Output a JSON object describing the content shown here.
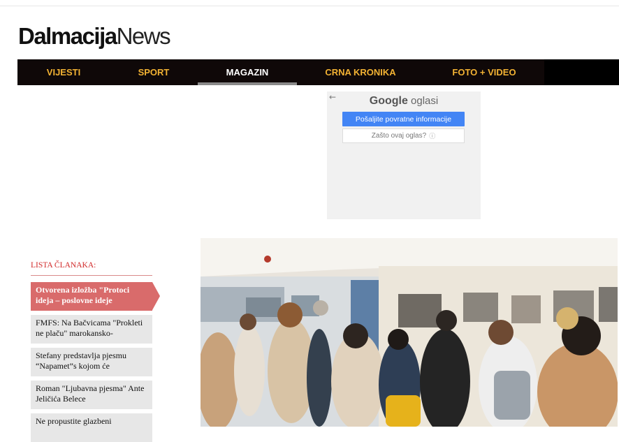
{
  "logo": {
    "bold": "Dalmacija",
    "light": "News"
  },
  "nav": {
    "items": [
      {
        "label": "VIJESTI"
      },
      {
        "label": "SPORT"
      },
      {
        "label": "MAGAZIN"
      },
      {
        "label": "CRNA KRONIKA"
      },
      {
        "label": "FOTO + VIDEO"
      }
    ],
    "active": "MAGAZIN"
  },
  "ad": {
    "back_arrow": "←",
    "brand_google": "Google",
    "brand_suffix": " oglasi",
    "feedback_button": "Pošaljite povratne informacije",
    "why_button": "Zašto ovaj oglas?",
    "info_glyph": "ⓘ"
  },
  "article_list": {
    "title": "LISTA ČLANAKA:",
    "items": [
      {
        "text": "Otvorena izložba \"Protoci ideja – poslovne ideje",
        "active": true
      },
      {
        "text": "FMFS: Na Bačvicama \"Prokleti ne plaču\" marokansko-",
        "active": false
      },
      {
        "text": "Stefany predstavlja pjesmu “Napamet”s kojom će",
        "active": false
      },
      {
        "text": "Roman \"Ljubavna pjesma\" Ante Jeličića Belece",
        "active": false
      },
      {
        "text": "Ne propustite glazbeni",
        "active": false
      }
    ]
  },
  "colors": {
    "nav_bg": "#0f0808",
    "nav_text": "#f2b233",
    "accent_red": "#d12a2a",
    "active_article": "#d96b6b",
    "google_blue": "#4385f5"
  }
}
